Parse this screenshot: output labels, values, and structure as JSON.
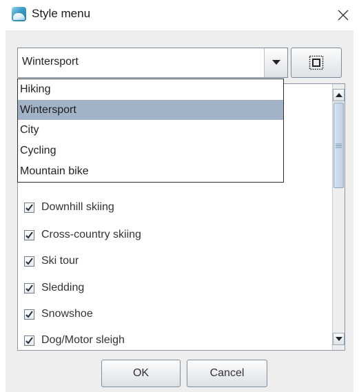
{
  "window": {
    "title": "Style menu",
    "icon": "app-icon",
    "close_icon": "close-icon"
  },
  "combo": {
    "value": "Wintersport",
    "options": [
      "Hiking",
      "Wintersport",
      "City",
      "Cycling",
      "Mountain bike"
    ],
    "selected_index": 1
  },
  "list": {
    "items": [
      {
        "label": "Downhill skiing",
        "checked": true
      },
      {
        "label": "Cross-country skiing",
        "checked": true
      },
      {
        "label": "Ski tour",
        "checked": true
      },
      {
        "label": "Sledding",
        "checked": true
      },
      {
        "label": "Snowshoe",
        "checked": true
      },
      {
        "label": "Dog/Motor sleigh",
        "checked": true
      }
    ]
  },
  "buttons": {
    "ok_label": "OK",
    "cancel_label": "Cancel"
  },
  "colors": {
    "selection": "#a2b3c7",
    "client_bg": "#eeeeee"
  }
}
